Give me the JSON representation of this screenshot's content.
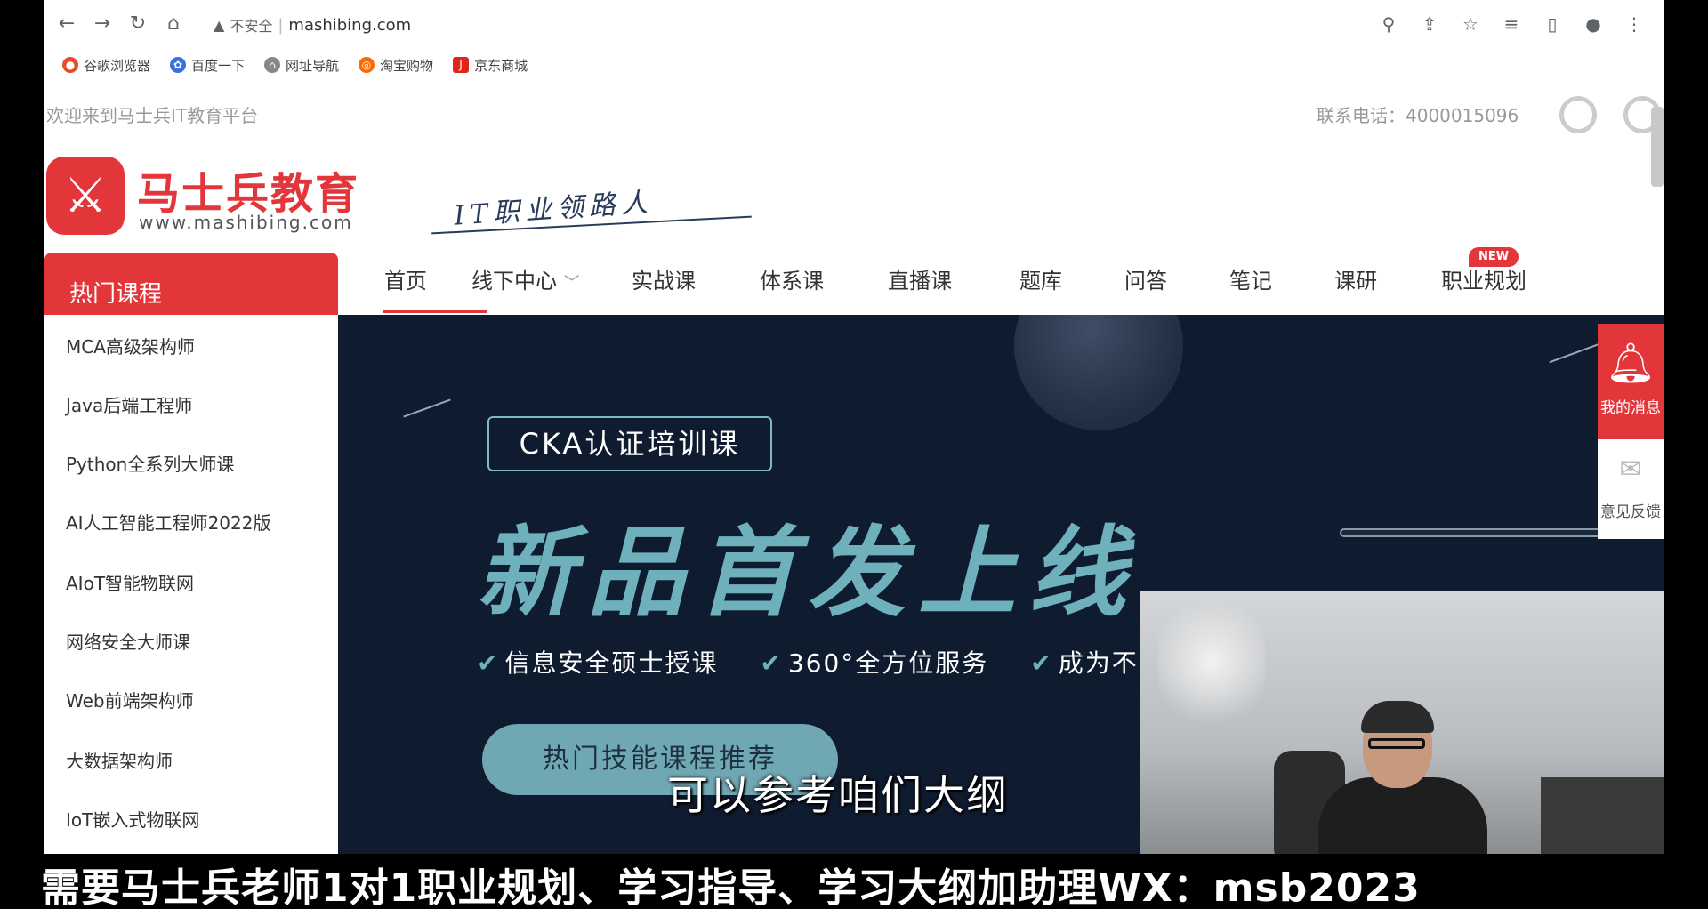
{
  "browser": {
    "url_warning": "不安全",
    "url": "mashibing.com",
    "bookmarks": [
      {
        "label": "谷歌浏览器",
        "color": "#e44d26"
      },
      {
        "label": "百度一下",
        "color": "#3b6fe0"
      },
      {
        "label": "网址导航",
        "color": "#888888"
      },
      {
        "label": "淘宝购物",
        "color": "#ff6a00"
      },
      {
        "label": "京东商城",
        "color": "#e1251b"
      }
    ]
  },
  "site": {
    "welcome": "欢迎来到马士兵IT教育平台",
    "phone": "联系电话：4000015096",
    "logo_name": "马士兵教育",
    "logo_url": "www.mashibing.com",
    "slogan": "IT职业领路人",
    "brand_color": "#e2363a"
  },
  "sidebar": {
    "title": "热门课程",
    "courses": [
      "MCA高级架构师",
      "Java后端工程师",
      "Python全系列大师课",
      "AI人工智能工程师2022版",
      "AIoT智能物联网",
      "网络安全大师课",
      "Web前端架构师",
      "大数据架构师",
      "IoT嵌入式物联网"
    ]
  },
  "nav": {
    "items": [
      "首页",
      "线下中心",
      "实战课",
      "体系课",
      "直播课",
      "题库",
      "问答",
      "笔记",
      "课研",
      "职业规划"
    ],
    "new_badge": "NEW"
  },
  "banner": {
    "tag": "CKA认证培训课",
    "headline": "新品首发上线",
    "features": [
      "信息安全硕士授课",
      "360°全方位服务",
      "成为不可"
    ],
    "cta": "热门技能课程推荐"
  },
  "float_panel": {
    "messages": "我的消息",
    "feedback": "意见反馈"
  },
  "overlay": {
    "subtitle": "可以参考咱们大纲",
    "bottom": "需要马士兵老师1对1职业规划、学习指导、学习大纲加助理WX：msb2023"
  }
}
